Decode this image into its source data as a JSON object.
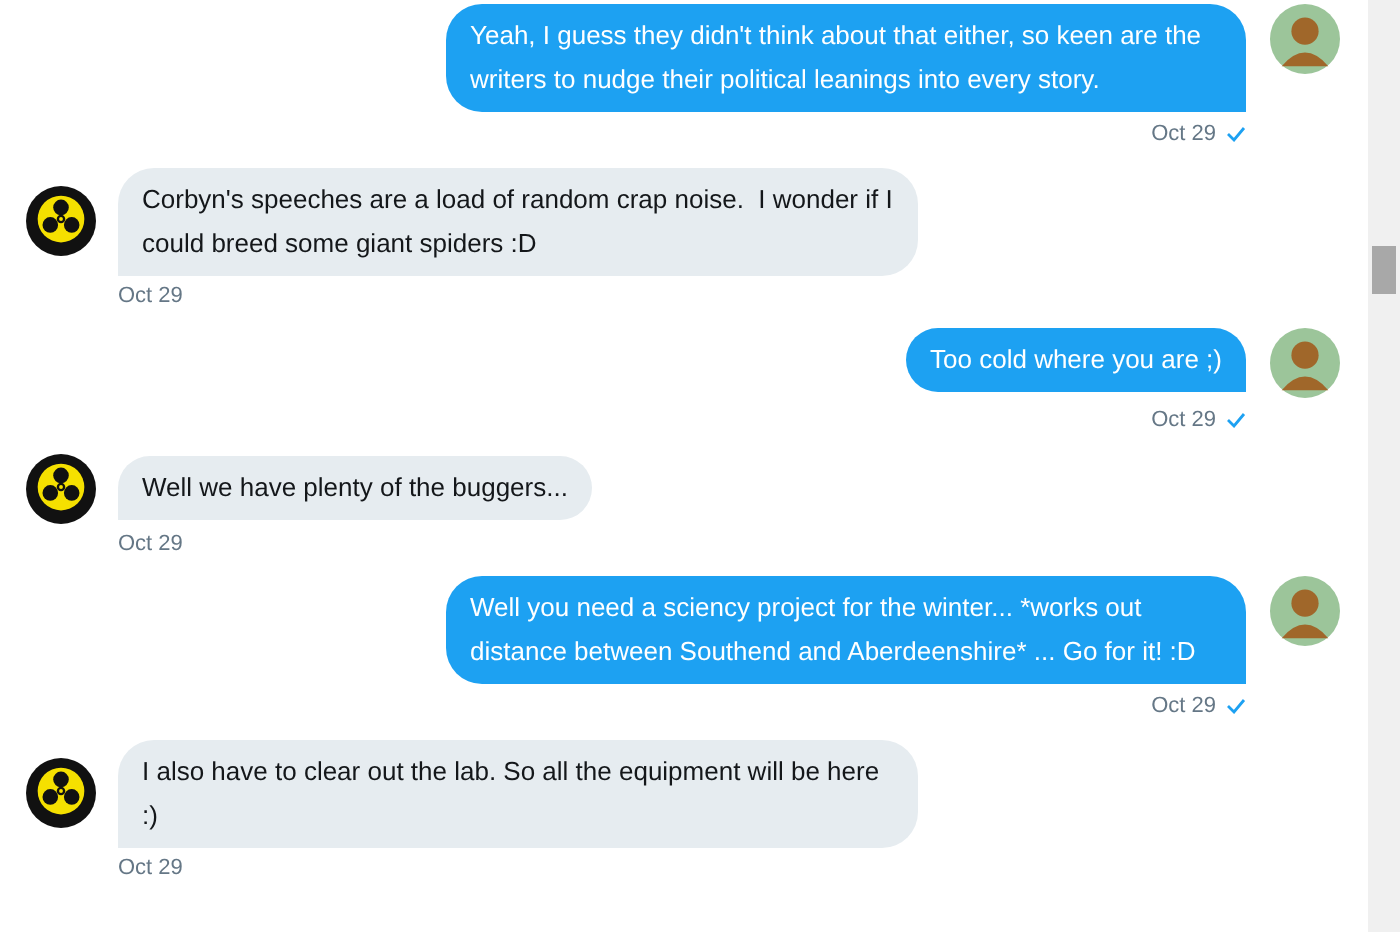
{
  "messages": [
    {
      "kind": "sent",
      "text": "Yeah, I guess they didn't think about that either, so keen are the writers to nudge their political leanings into every story.",
      "date": "Oct 29",
      "seen": true
    },
    {
      "kind": "received",
      "text": "Corbyn's speeches are a load of random crap noise.  I wonder if I could breed some giant spiders :D",
      "date": "Oct 29",
      "seen": false
    },
    {
      "kind": "sent",
      "text": "Too cold where you are ;)",
      "date": "Oct 29",
      "seen": true
    },
    {
      "kind": "received",
      "text": "Well we have plenty of the buggers...",
      "date": "Oct 29",
      "seen": false
    },
    {
      "kind": "sent",
      "text": "Well you need a sciency project for the winter... *works out distance between Southend and Aberdeenshire* ... Go for it! :D",
      "date": "Oct 29",
      "seen": true
    },
    {
      "kind": "received",
      "text": "I also have to clear out the lab. So all the equipment will be here :)",
      "date": "Oct 29",
      "seen": false
    }
  ]
}
